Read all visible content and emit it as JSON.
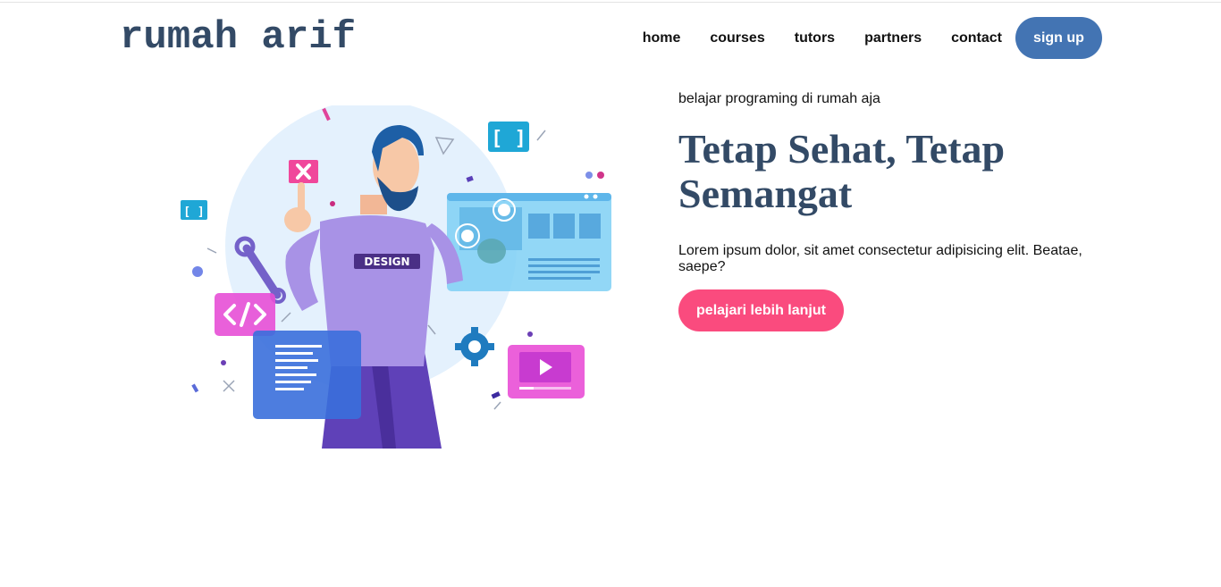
{
  "header": {
    "logo": "rumah arif",
    "nav": [
      "home",
      "courses",
      "tutors",
      "partners",
      "contact"
    ],
    "signup": "sign up"
  },
  "hero": {
    "kicker": "belajar programing di rumah aja",
    "headline": "Tetap Sehat, Tetap Semangat",
    "description": "Lorem ipsum dolor, sit amet consectetur adipisicing elit. Beatae, saepe?",
    "cta": "pelajari lebih lanjut"
  },
  "illustration": {
    "badge_text": "DESIGN",
    "icons": [
      "close-icon",
      "wrench-icon",
      "code-icon",
      "gear-icon",
      "play-icon",
      "brackets-icon"
    ]
  },
  "colors": {
    "brand": "#334a66",
    "signup_bg": "#4374b3",
    "cta_bg": "#fa4b7e"
  }
}
